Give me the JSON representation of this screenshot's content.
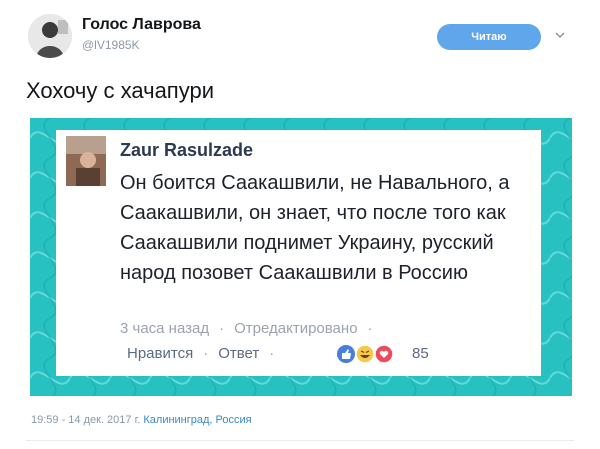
{
  "header": {
    "author_name": "Голос Лаврова",
    "author_handle": "@lV1985K",
    "follow_label": "Читаю"
  },
  "tweet": {
    "text": "Хохочу с хачапури"
  },
  "comment": {
    "name": "Zaur Rasulzade",
    "body": "Он боится Саакашвили, не Навального, а Саакашвили, он знает, что после того как Саакашвили поднимет Украину, русский народ позовет Саакашвили в Россию",
    "time_ago": "3 часа назад",
    "edited": "Отредактировано",
    "like": "Нравится",
    "reply": "Ответ",
    "reaction_count": "85",
    "reaction_icons": [
      "like-icon",
      "haha-icon",
      "love-icon"
    ]
  },
  "footer": {
    "time": "19:59 - 14 дек. 2017 г.",
    "location": "Калининград, Россия"
  },
  "colors": {
    "frame": "#27c1c1",
    "button": "#5fa6ea",
    "link": "#3b88c3"
  }
}
